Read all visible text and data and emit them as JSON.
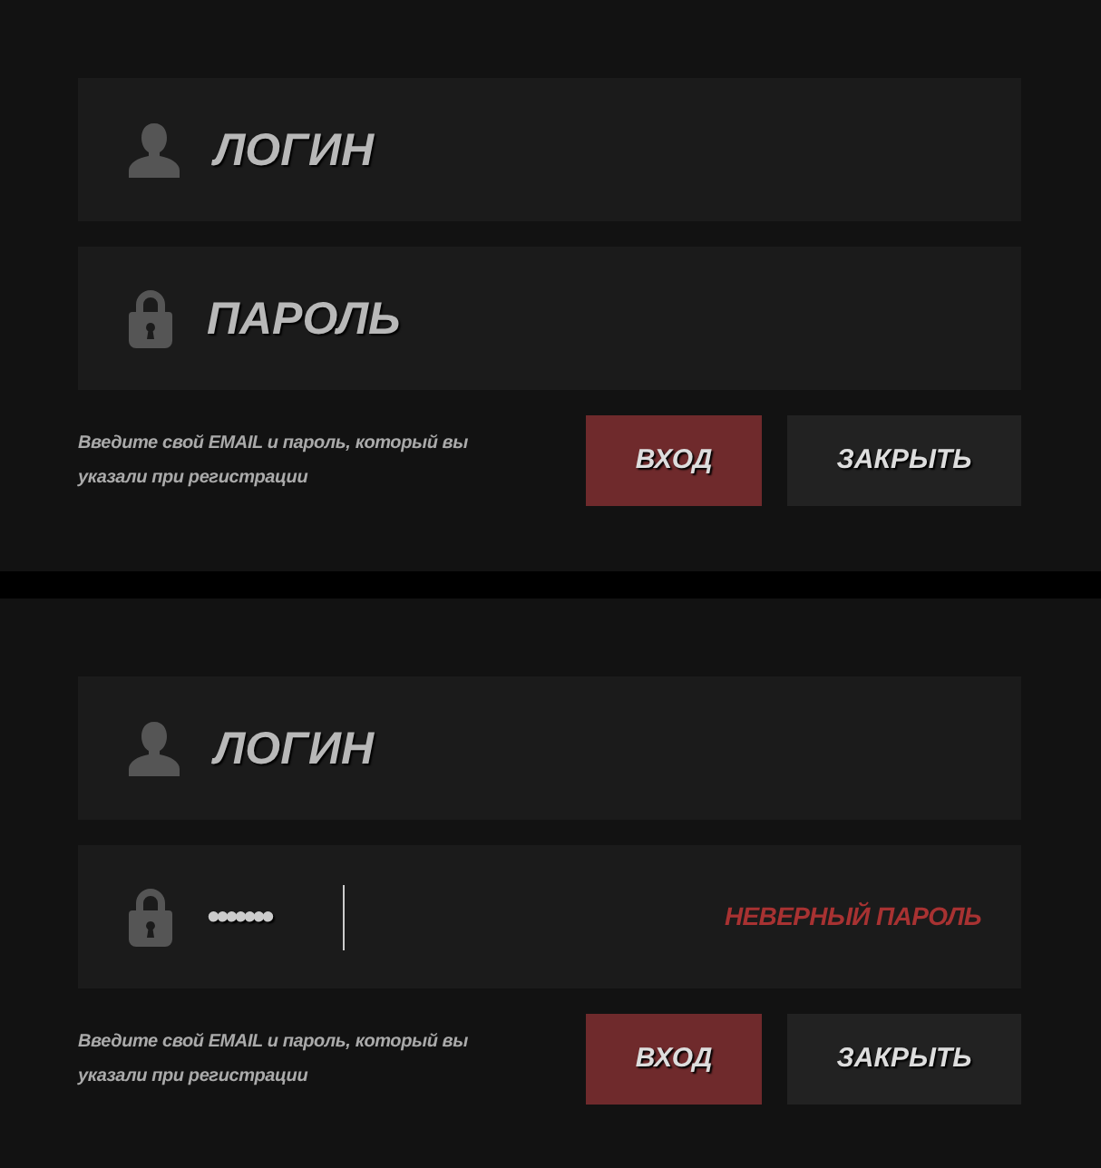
{
  "panels": [
    {
      "fields": [
        {
          "kind": "login",
          "placeholder": "ЛОГИН"
        },
        {
          "kind": "password",
          "placeholder": "ПАРОЛЬ"
        }
      ],
      "hint": "Введите свой EMAIL и пароль, который вы указали при регистрации",
      "buttons": [
        {
          "label": "ВХОД",
          "kind": "primary"
        },
        {
          "label": "ЗАКРЫТЬ",
          "kind": "secondary"
        }
      ]
    },
    {
      "fields": [
        {
          "kind": "login",
          "placeholder": "ЛОГИН"
        },
        {
          "kind": "password",
          "value": "•••••••",
          "focused": true,
          "error": "НЕВЕРНЫЙ ПАРОЛЬ"
        }
      ],
      "hint": "Введите свой EMAIL и пароль, который вы указали при регистрации",
      "buttons": [
        {
          "label": "ВХОД",
          "kind": "primary"
        },
        {
          "label": "ЗАКРЫТЬ",
          "kind": "secondary"
        }
      ]
    }
  ]
}
